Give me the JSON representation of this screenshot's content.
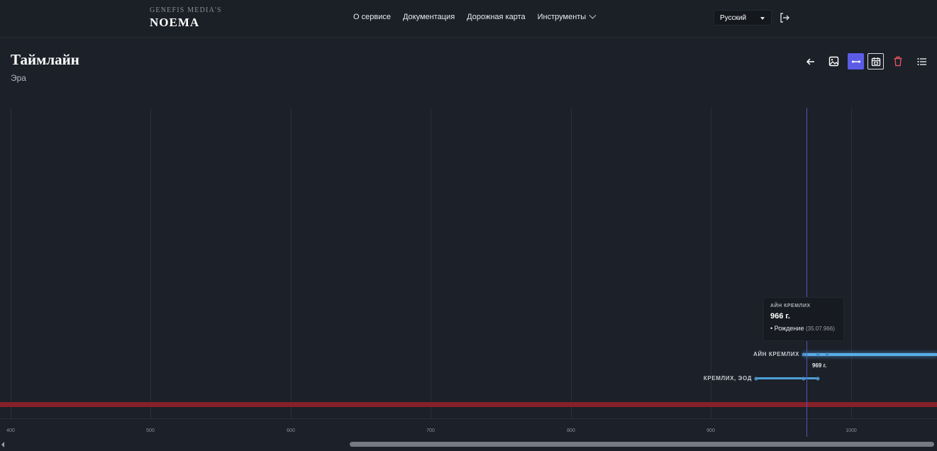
{
  "brand": {
    "small": "GENEFIS MEDIA'S",
    "name": "NOEMA"
  },
  "nav": [
    {
      "label": "О сервисе"
    },
    {
      "label": "Документация"
    },
    {
      "label": "Дорожная карта"
    },
    {
      "label": "Инструменты"
    }
  ],
  "language": {
    "selected": "Русский"
  },
  "page": {
    "title": "Таймлайн",
    "subtitle": "Эра"
  },
  "toolbar": {
    "icons": [
      "arrow-left-icon",
      "image-icon",
      "expand-horizontal-icon",
      "calendar-icon",
      "trash-icon",
      "list-icon"
    ],
    "active": "expand-horizontal-icon",
    "danger_color": "#e0505c",
    "accent_color": "#5b5ce6"
  },
  "axis": {
    "ticks": [
      "400",
      "500",
      "600",
      "700",
      "800",
      "900",
      "1000"
    ]
  },
  "rows": [
    {
      "label": "АЙН КРЕМЛИХ",
      "year_label": "969 г."
    },
    {
      "label": "КРЕМЛИХ, ЭОД"
    }
  ],
  "tooltip": {
    "name": "АЙН КРЕМЛИХ",
    "year": "966 г.",
    "event": "• Рождение",
    "event_date": "(35.07.966)"
  },
  "colors": {
    "era_band": "#86202a",
    "bar": "#4e9fd8",
    "cursor": "#5553b3"
  }
}
